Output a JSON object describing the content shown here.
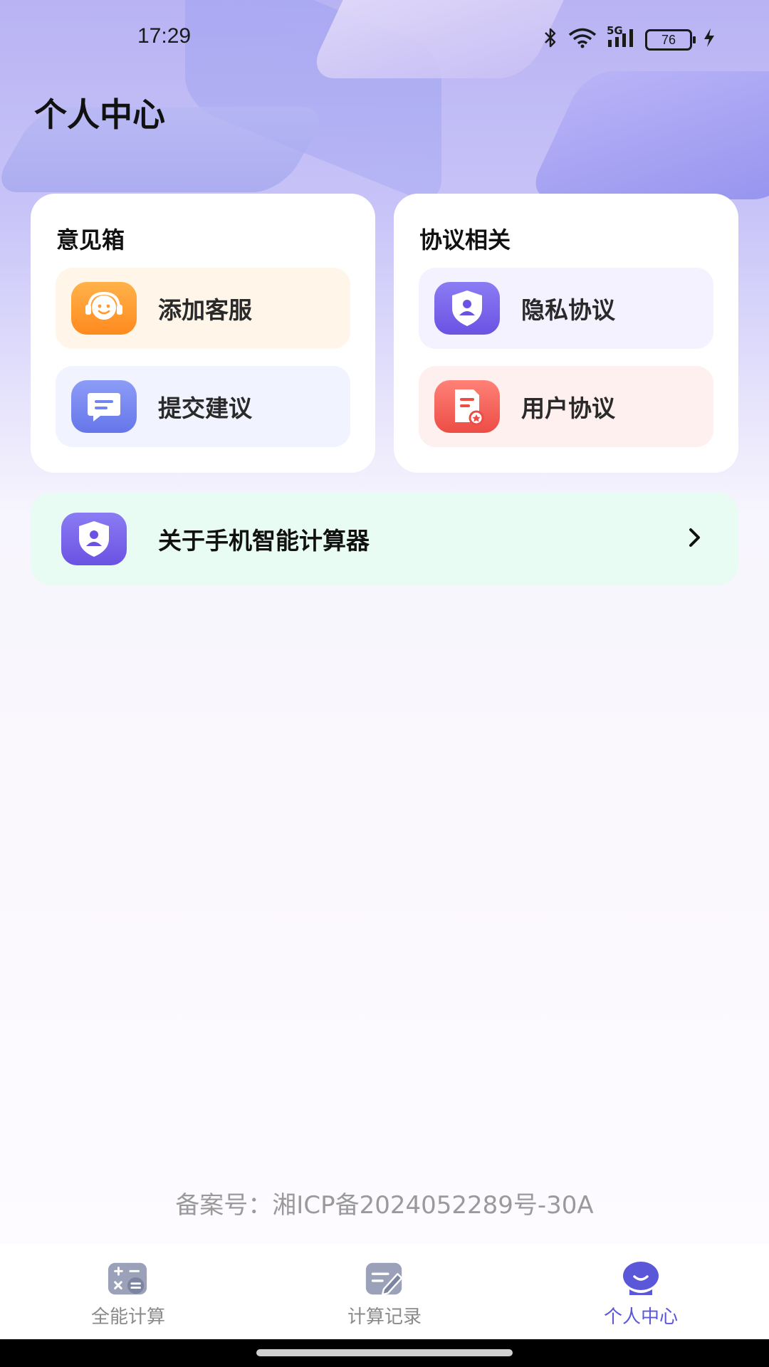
{
  "status_bar": {
    "time": "17:29",
    "network": "5G",
    "battery": "76",
    "icons": [
      "bluetooth-icon",
      "wifi-icon",
      "signal-icon",
      "battery-icon",
      "charging-icon"
    ]
  },
  "header": {
    "title": "个人中心"
  },
  "feedback_card": {
    "title": "意见箱",
    "items": [
      {
        "label": "添加客服",
        "icon": "customer-service-icon",
        "color": "#ff9a2e"
      },
      {
        "label": "提交建议",
        "icon": "message-icon",
        "color": "#7484ee"
      }
    ]
  },
  "agreement_card": {
    "title": "协议相关",
    "items": [
      {
        "label": "隐私协议",
        "icon": "privacy-shield-icon",
        "color": "#7a66ea"
      },
      {
        "label": "用户协议",
        "icon": "document-icon",
        "color": "#f0605a"
      }
    ]
  },
  "about": {
    "label": "关于手机智能计算器",
    "icon": "shield-user-icon"
  },
  "footer": {
    "icp": "备案号：湘ICP备2024052289号-30A"
  },
  "bottom_nav": {
    "items": [
      {
        "label": "全能计算",
        "icon": "calculator-icon",
        "active": false
      },
      {
        "label": "计算记录",
        "icon": "record-edit-icon",
        "active": false
      },
      {
        "label": "个人中心",
        "icon": "profile-icon",
        "active": true
      }
    ],
    "active_color": "#5a57d8",
    "inactive_color": "#8a8a8a"
  }
}
